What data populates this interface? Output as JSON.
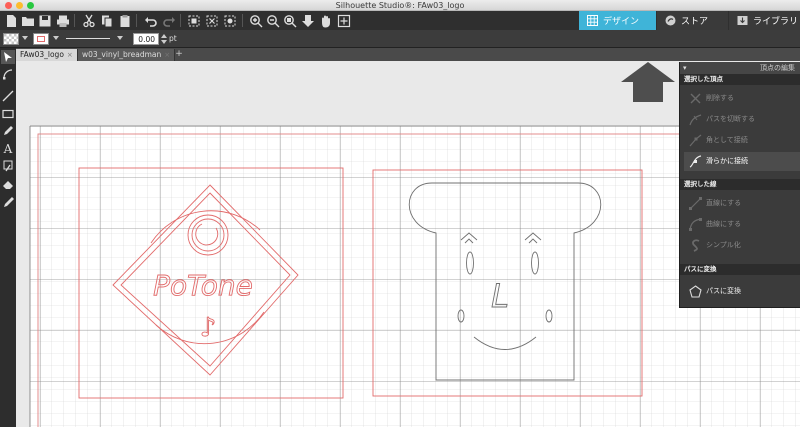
{
  "window": {
    "title": "Silhouette Studio®: FAw03_logo"
  },
  "nav_tabs": [
    {
      "label": "デザイン",
      "active": true
    },
    {
      "label": "ストア",
      "active": false
    },
    {
      "label": "ライブラリ",
      "active": false
    }
  ],
  "properties": {
    "stroke_width": "0.00",
    "unit": "pt"
  },
  "doc_tabs": [
    {
      "label": "FAw03_logo",
      "active": true
    },
    {
      "label": "w03_vinyl_breadman",
      "active": false
    }
  ],
  "add_tab_label": "+",
  "logo": {
    "text": "PoTone",
    "note_glyph": "♪"
  },
  "bread": {
    "nose_text": "L"
  },
  "panel": {
    "title": "頂点の編集",
    "sections": [
      {
        "heading": "選択した頂点",
        "items": [
          {
            "label": "削除する",
            "icon": "delete-point-icon",
            "state": "disabled"
          },
          {
            "label": "パスを切断する",
            "icon": "cut-path-icon",
            "state": "disabled"
          },
          {
            "label": "角として接続",
            "icon": "corner-join-icon",
            "state": "disabled"
          },
          {
            "label": "滑らかに接続",
            "icon": "smooth-join-icon",
            "state": "active"
          }
        ]
      },
      {
        "heading": "選択した線",
        "items": [
          {
            "label": "直線にする",
            "icon": "make-straight-icon",
            "state": "disabled"
          },
          {
            "label": "曲線にする",
            "icon": "make-curve-icon",
            "state": "disabled"
          },
          {
            "label": "シンプル化",
            "icon": "simplify-icon",
            "state": "disabled"
          }
        ]
      },
      {
        "heading": "パスに変換",
        "items": [
          {
            "label": "パスに変換",
            "icon": "convert-to-path-icon",
            "state": "enabled"
          }
        ]
      }
    ]
  },
  "colors": {
    "nav_active": "#3fb4d8",
    "cut_line": "#e26b6b",
    "page_margin": "#e08080",
    "drawing": "#707070",
    "annotation_arrow": "#4e4e4e"
  }
}
